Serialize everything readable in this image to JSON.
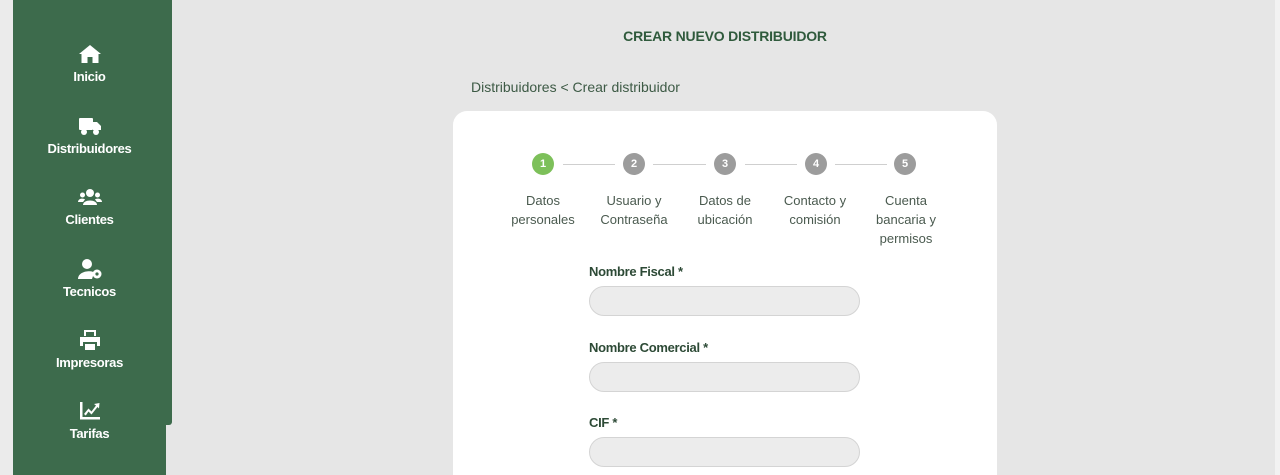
{
  "sidebar": {
    "items": [
      {
        "label": "Inicio",
        "icon": "home-icon"
      },
      {
        "label": "Distribuidores",
        "icon": "truck-icon"
      },
      {
        "label": "Clientes",
        "icon": "users-icon"
      },
      {
        "label": "Tecnicos",
        "icon": "user-gear-icon"
      },
      {
        "label": "Impresoras",
        "icon": "printer-icon"
      },
      {
        "label": "Tarifas",
        "icon": "chart-line-icon"
      }
    ]
  },
  "header": {
    "title": "CREAR NUEVO DISTRIBUIDOR",
    "breadcrumb": "Distribuidores < Crear distribuidor"
  },
  "stepper": {
    "steps": [
      {
        "number": "1",
        "line1": "Datos",
        "line2": "personales",
        "line3": "",
        "active": true
      },
      {
        "number": "2",
        "line1": "Usuario y",
        "line2": "Contraseña",
        "line3": "",
        "active": false
      },
      {
        "number": "3",
        "line1": "Datos de",
        "line2": "ubicación",
        "line3": "",
        "active": false
      },
      {
        "number": "4",
        "line1": "Contacto y",
        "line2": "comisión",
        "line3": "",
        "active": false
      },
      {
        "number": "5",
        "line1": "Cuenta",
        "line2": "bancaria y",
        "line3": "permisos",
        "active": false
      }
    ]
  },
  "form": {
    "fields": [
      {
        "label": "Nombre Fiscal *",
        "value": ""
      },
      {
        "label": "Nombre Comercial *",
        "value": ""
      },
      {
        "label": "CIF *",
        "value": ""
      }
    ]
  },
  "colors": {
    "sidebar": "#3d6b4c",
    "active_step": "#7dc05a",
    "idle_step": "#9c9c9c",
    "background": "#e6e6e6"
  }
}
